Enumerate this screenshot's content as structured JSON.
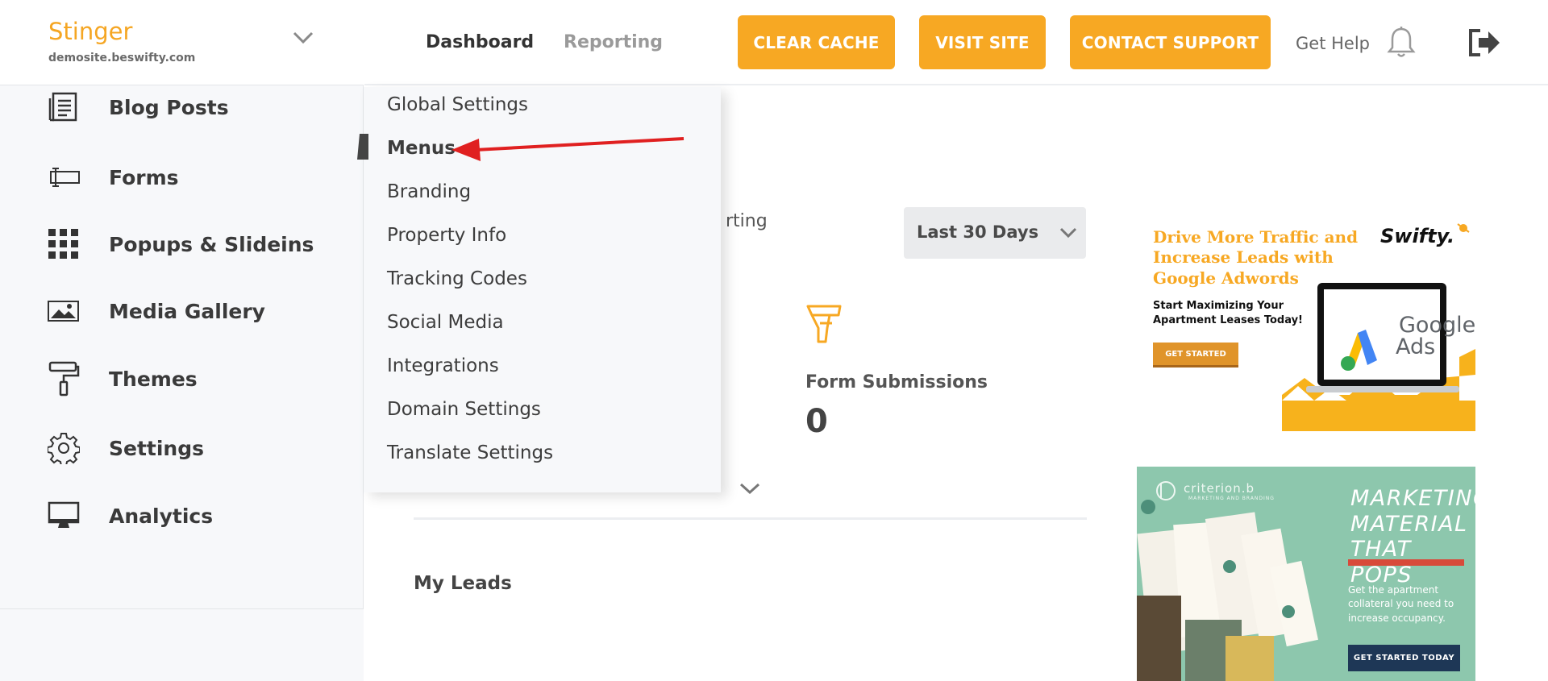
{
  "site": {
    "name": "Stinger",
    "url": "demosite.beswifty.com"
  },
  "sidebar": {
    "items": [
      {
        "label": "Blog Posts",
        "icon": "document-lines-icon"
      },
      {
        "label": "Forms",
        "icon": "form-field-icon"
      },
      {
        "label": "Popups & Slideins",
        "icon": "grid-icon"
      },
      {
        "label": "Media Gallery",
        "icon": "image-icon"
      },
      {
        "label": "Themes",
        "icon": "paint-roller-icon"
      },
      {
        "label": "Settings",
        "icon": "gear-icon"
      },
      {
        "label": "Analytics",
        "icon": "monitor-icon"
      }
    ]
  },
  "topbar": {
    "tabs": [
      {
        "label": "Dashboard",
        "active": true
      },
      {
        "label": "Reporting",
        "active": false
      }
    ],
    "buttons": {
      "clear_cache": "CLEAR CACHE",
      "visit_site": "VISIT SITE",
      "contact_support": "CONTACT SUPPORT"
    },
    "get_help": "Get Help",
    "icons": {
      "bell": "bell-icon",
      "logout": "logout-icon"
    }
  },
  "dropdown": {
    "items": [
      {
        "label": "Global Settings",
        "active": false
      },
      {
        "label": "Menus",
        "active": true
      },
      {
        "label": "Branding",
        "active": false
      },
      {
        "label": "Property Info",
        "active": false
      },
      {
        "label": "Tracking Codes",
        "active": false
      },
      {
        "label": "Social Media",
        "active": false
      },
      {
        "label": "Integrations",
        "active": false
      },
      {
        "label": "Domain Settings",
        "active": false
      },
      {
        "label": "Translate Settings",
        "active": false
      }
    ]
  },
  "main": {
    "partial_text": "rting",
    "date_range": "Last 30 Days",
    "stat": {
      "label": "Form Submissions",
      "value": "0"
    },
    "section_title": "My Leads"
  },
  "ads": {
    "adwords": {
      "headline": "Drive More Traffic and Increase Leads with Google Adwords",
      "sub": "Start Maximizing Your Apartment Leases Today!",
      "cta": "GET STARTED",
      "brand": "Swifty.",
      "product_line1": "Google",
      "product_line2": "Ads"
    },
    "criterion": {
      "logo": "criterion.b",
      "logo_sub": "MARKETING AND BRANDING",
      "headline_line1": "MARKETING",
      "headline_line2": "MATERIAL",
      "headline_line3": "THAT POPS",
      "body": "Get the apartment collateral you need to increase occupancy.",
      "cta": "GET STARTED TODAY"
    }
  },
  "colors": {
    "accent": "#f7a823",
    "arrow": "#e02020",
    "sidebar_bg": "#f7f8fa"
  }
}
